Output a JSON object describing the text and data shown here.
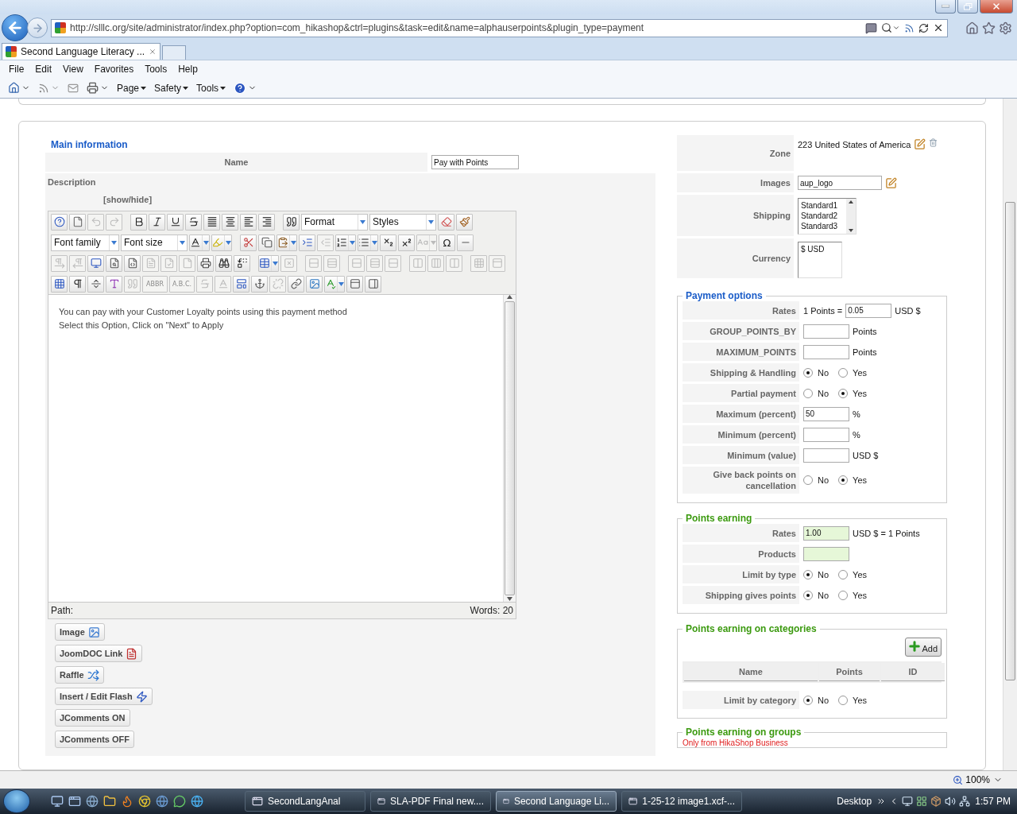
{
  "browser": {
    "url": "http://slllc.org/site/administrator/index.php?option=com_hikashop&ctrl=plugins&task=edit&name=alphauserpoints&plugin_type=payment",
    "tabs": [
      {
        "title": "Second Language Literacy ...",
        "selected": true
      }
    ],
    "menu": [
      "File",
      "Edit",
      "View",
      "Favorites",
      "Tools",
      "Help"
    ],
    "commands": [
      "Page",
      "Safety",
      "Tools"
    ],
    "zoom": "100%"
  },
  "main_information": {
    "legend": "Main information",
    "name_label": "Name",
    "name_value": "Pay with Points",
    "description_label": "Description",
    "toggle": "[show/hide]",
    "editor": {
      "toolbar": [
        [
          {
            "kind": "icon",
            "disabled": false,
            "dropdown": false
          },
          {
            "kind": "icon",
            "disabled": false,
            "dropdown": false
          },
          {
            "kind": "icon",
            "disabled": true,
            "dropdown": false
          },
          {
            "kind": "icon",
            "disabled": true,
            "dropdown": false
          },
          {
            "kind": "separator"
          },
          {
            "kind": "icon",
            "disabled": false,
            "dropdown": false
          },
          {
            "kind": "icon",
            "disabled": false,
            "dropdown": false
          },
          {
            "kind": "icon",
            "disabled": false,
            "dropdown": false
          },
          {
            "kind": "icon",
            "disabled": false,
            "dropdown": false
          },
          {
            "kind": "icon",
            "disabled": false,
            "dropdown": false
          },
          {
            "kind": "icon",
            "disabled": false,
            "dropdown": false
          },
          {
            "kind": "icon",
            "disabled": false,
            "dropdown": false
          },
          {
            "kind": "icon",
            "disabled": false,
            "dropdown": false
          },
          {
            "kind": "separator"
          },
          {
            "kind": "icon",
            "disabled": false,
            "dropdown": false
          },
          {
            "kind": "select",
            "label": "Format"
          },
          {
            "kind": "select",
            "label": "Styles"
          },
          {
            "kind": "icon",
            "disabled": false,
            "dropdown": false
          },
          {
            "kind": "icon",
            "disabled": false,
            "dropdown": false
          }
        ],
        [
          {
            "kind": "select",
            "label": "Font family"
          },
          {
            "kind": "select",
            "label": "Font size"
          },
          {
            "kind": "icon",
            "disabled": false,
            "dropdown": true
          },
          {
            "kind": "icon",
            "disabled": false,
            "dropdown": true
          },
          {
            "kind": "separator"
          },
          {
            "kind": "icon",
            "disabled": false,
            "dropdown": false
          },
          {
            "kind": "icon",
            "disabled": false,
            "dropdown": false
          },
          {
            "kind": "icon",
            "disabled": false,
            "dropdown": true
          },
          {
            "kind": "icon",
            "disabled": false,
            "dropdown": false
          },
          {
            "kind": "icon",
            "disabled": true,
            "dropdown": false
          },
          {
            "kind": "icon",
            "disabled": false,
            "dropdown": true
          },
          {
            "kind": "icon",
            "disabled": false,
            "dropdown": true
          },
          {
            "kind": "icon",
            "disabled": false,
            "dropdown": false
          },
          {
            "kind": "icon",
            "disabled": false,
            "dropdown": false
          },
          {
            "kind": "icon",
            "disabled": true,
            "dropdown": true
          },
          {
            "kind": "glyph",
            "label": "Ω",
            "disabled": false,
            "dropdown": false
          },
          {
            "kind": "icon",
            "disabled": false,
            "dropdown": false
          }
        ],
        [
          {
            "kind": "icon",
            "disabled": true,
            "dropdown": false
          },
          {
            "kind": "icon",
            "disabled": true,
            "dropdown": false
          },
          {
            "kind": "icon",
            "disabled": false,
            "dropdown": false
          },
          {
            "kind": "icon",
            "disabled": false,
            "dropdown": false
          },
          {
            "kind": "icon",
            "disabled": false,
            "dropdown": false
          },
          {
            "kind": "icon",
            "disabled": true,
            "dropdown": false
          },
          {
            "kind": "icon",
            "disabled": true,
            "dropdown": false
          },
          {
            "kind": "icon",
            "disabled": true,
            "dropdown": false
          },
          {
            "kind": "icon",
            "disabled": false,
            "dropdown": false
          },
          {
            "kind": "icon",
            "disabled": false,
            "dropdown": false
          },
          {
            "kind": "icon",
            "disabled": false,
            "dropdown": false
          },
          {
            "kind": "separator"
          },
          {
            "kind": "icon",
            "disabled": false,
            "dropdown": true
          },
          {
            "kind": "icon",
            "disabled": true,
            "dropdown": false
          },
          {
            "kind": "separator"
          },
          {
            "kind": "icon",
            "disabled": true,
            "dropdown": false
          },
          {
            "kind": "icon",
            "disabled": true,
            "dropdown": false
          },
          {
            "kind": "separator"
          },
          {
            "kind": "icon",
            "disabled": true,
            "dropdown": false
          },
          {
            "kind": "icon",
            "disabled": true,
            "dropdown": false
          },
          {
            "kind": "icon",
            "disabled": true,
            "dropdown": false
          },
          {
            "kind": "separator"
          },
          {
            "kind": "icon",
            "disabled": true,
            "dropdown": false
          },
          {
            "kind": "icon",
            "disabled": true,
            "dropdown": false
          },
          {
            "kind": "icon",
            "disabled": true,
            "dropdown": false
          },
          {
            "kind": "separator"
          },
          {
            "kind": "icon",
            "disabled": true,
            "dropdown": false
          },
          {
            "kind": "icon",
            "disabled": true,
            "dropdown": false
          }
        ],
        [
          {
            "kind": "icon",
            "disabled": false,
            "dropdown": false
          },
          {
            "kind": "icon",
            "disabled": false,
            "dropdown": false
          },
          {
            "kind": "icon",
            "disabled": false,
            "dropdown": false
          },
          {
            "kind": "icon",
            "disabled": false,
            "dropdown": false
          },
          {
            "kind": "icon",
            "disabled": true,
            "dropdown": false
          },
          {
            "kind": "glyph",
            "label": "ABBR",
            "disabled": true,
            "dropdown": false
          },
          {
            "kind": "glyph",
            "label": "A.B.C.",
            "disabled": true,
            "dropdown": false
          },
          {
            "kind": "icon",
            "disabled": true,
            "dropdown": false
          },
          {
            "kind": "icon",
            "disabled": true,
            "dropdown": false
          },
          {
            "kind": "icon",
            "disabled": false,
            "dropdown": false
          },
          {
            "kind": "icon",
            "disabled": false,
            "dropdown": false
          },
          {
            "kind": "icon",
            "disabled": true,
            "dropdown": false
          },
          {
            "kind": "icon",
            "disabled": false,
            "dropdown": false
          },
          {
            "kind": "icon",
            "disabled": false,
            "dropdown": false
          },
          {
            "kind": "icon",
            "disabled": false,
            "dropdown": true
          },
          {
            "kind": "icon",
            "disabled": false,
            "dropdown": false
          },
          {
            "kind": "icon",
            "disabled": false,
            "dropdown": false
          }
        ]
      ],
      "content": [
        "You can pay with your Customer Loyalty points using this payment method",
        "Select this Option, Click on \"Next\" to Apply"
      ],
      "path_label": "Path:",
      "word_count": "Words: 20"
    },
    "buttons": [
      {
        "label": "Image",
        "kind": "icon"
      },
      {
        "label": "JoomDOC Link",
        "kind": "icon"
      },
      {
        "label": "Raffle",
        "kind": "icon"
      },
      {
        "label": "Insert / Edit Flash",
        "kind": "icon"
      },
      {
        "label": "JComments ON",
        "kind": "plain"
      },
      {
        "label": "JComments OFF",
        "kind": "plain"
      }
    ]
  },
  "settings": [
    {
      "kind": "zone",
      "label": "Zone",
      "value": "223 United States of America"
    },
    {
      "kind": "image",
      "label": "Images",
      "value": "aup_logo"
    },
    {
      "kind": "listbox",
      "label": "Shipping",
      "options": [
        "Standard1",
        "Standard2",
        "Standard3"
      ]
    },
    {
      "kind": "listbox",
      "label": "Currency",
      "options": [
        "$ USD"
      ]
    }
  ],
  "payment_options": {
    "legend": "Payment options",
    "rows": [
      {
        "kind": "rate",
        "label": "Rates",
        "prefix": "1 Points =",
        "value": "0.05",
        "suffix": "USD $",
        "highlighted": false
      },
      {
        "kind": "input",
        "label": "GROUP_POINTS_BY",
        "suffix": "Points",
        "highlighted": false
      },
      {
        "kind": "input",
        "label": "MAXIMUM_POINTS",
        "suffix": "Points",
        "highlighted": false
      },
      {
        "kind": "radio",
        "label": "Shipping & Handling",
        "options": [
          {
            "label": "No",
            "selected": true
          },
          {
            "label": "Yes",
            "selected": false
          }
        ]
      },
      {
        "kind": "radio",
        "label": "Partial payment",
        "options": [
          {
            "label": "No",
            "selected": false
          },
          {
            "label": "Yes",
            "selected": true
          }
        ]
      },
      {
        "kind": "input",
        "label": "Maximum (percent)",
        "value": "50",
        "suffix": "%",
        "highlighted": false
      },
      {
        "kind": "input",
        "label": "Minimum (percent)",
        "suffix": "%",
        "highlighted": false
      },
      {
        "kind": "input",
        "label": "Minimum (value)",
        "suffix": "USD $",
        "highlighted": false
      },
      {
        "kind": "radio",
        "label": "Give back points on cancellation",
        "options": [
          {
            "label": "No",
            "selected": false
          },
          {
            "label": "Yes",
            "selected": true
          }
        ]
      }
    ]
  },
  "points_earning": {
    "legend": "Points earning",
    "rows": [
      {
        "kind": "input",
        "label": "Rates",
        "value": "1.00",
        "suffix": "USD $ = 1 Points",
        "highlighted": true
      },
      {
        "kind": "input",
        "label": "Products",
        "highlighted": true
      },
      {
        "kind": "radio",
        "label": "Limit by type",
        "options": [
          {
            "label": "No",
            "selected": true
          },
          {
            "label": "Yes",
            "selected": false
          }
        ]
      },
      {
        "kind": "radio",
        "label": "Shipping gives points",
        "options": [
          {
            "label": "No",
            "selected": true
          },
          {
            "label": "Yes",
            "selected": false
          }
        ]
      }
    ]
  },
  "categories": {
    "legend": "Points earning on categories",
    "add_button": "Add",
    "columns": [
      "Name",
      "Points",
      "ID"
    ],
    "rows": [
      {
        "kind": "radio",
        "label": "Limit by category",
        "options": [
          {
            "label": "No",
            "selected": true
          },
          {
            "label": "Yes",
            "selected": false
          }
        ]
      }
    ]
  },
  "groups": {
    "legend": "Points earning on groups",
    "note": "Only from HikaShop Business"
  },
  "taskbar": {
    "tasks": [
      {
        "label": "SecondLangAnal",
        "selected": false
      },
      {
        "label": "SLA-PDF Final new....",
        "selected": false
      },
      {
        "label": "Second Language Li...",
        "selected": true
      },
      {
        "label": "1-25-12 image1.xcf-...",
        "selected": false
      }
    ],
    "desktop": "Desktop",
    "time": "1:57 PM"
  }
}
